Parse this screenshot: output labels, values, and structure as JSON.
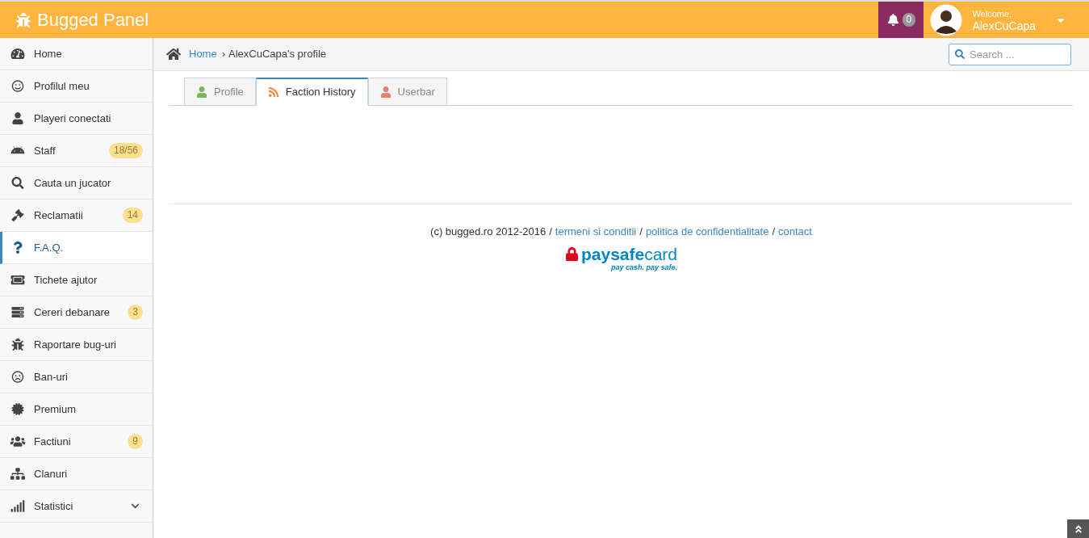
{
  "header": {
    "title": "Bugged Panel",
    "notifications": "0",
    "welcome": "Welcome,",
    "user": "AlexCuCapa"
  },
  "sidebar": {
    "items": [
      {
        "label": "Home",
        "selected": false,
        "kind": "link"
      },
      {
        "label": "Profilul meu",
        "selected": false,
        "kind": "link"
      },
      {
        "label": "Playeri conectati",
        "selected": false,
        "kind": "link"
      },
      {
        "label": "Staff",
        "badge": "18/56",
        "selected": false,
        "kind": "link"
      },
      {
        "label": "Cauta un jucator",
        "selected": false,
        "kind": "link"
      },
      {
        "label": "Reclamatii",
        "badge": "14",
        "selected": false,
        "kind": "link"
      },
      {
        "label": "F.A.Q.",
        "selected": true,
        "kind": "link"
      },
      {
        "label": "Tichete ajutor",
        "selected": false,
        "kind": "link"
      },
      {
        "label": "Cereri debanare",
        "badge": "3",
        "selected": false,
        "kind": "link"
      },
      {
        "label": "Raportare bug-uri",
        "selected": false,
        "kind": "link"
      },
      {
        "label": "Ban-uri",
        "selected": false,
        "kind": "link"
      },
      {
        "label": "Premium",
        "selected": false,
        "kind": "link"
      },
      {
        "label": "Factiuni",
        "badge": "9",
        "selected": false,
        "kind": "link"
      },
      {
        "label": "Clanuri",
        "selected": false,
        "kind": "link"
      },
      {
        "label": "Statistici",
        "selected": false,
        "kind": "submenu"
      }
    ]
  },
  "breadcrumb": {
    "home": "Home",
    "separator": "›",
    "current": "AlexCuCapa's profile"
  },
  "search": {
    "placeholder": "Search ..."
  },
  "tabs": [
    {
      "label": "Profile",
      "selected": false
    },
    {
      "label": "Faction History",
      "selected": true
    },
    {
      "label": "Userbar",
      "selected": false
    }
  ],
  "footer": {
    "copyright": "(c) bugged.ro 2012-2016",
    "separator": "/",
    "links": [
      "termeni si conditii",
      "politica de confidentialitate",
      "contact"
    ]
  },
  "payment": {
    "brand_bold": "paysafe",
    "brand_light": "card",
    "slogan": "pay cash. pay safe."
  }
}
